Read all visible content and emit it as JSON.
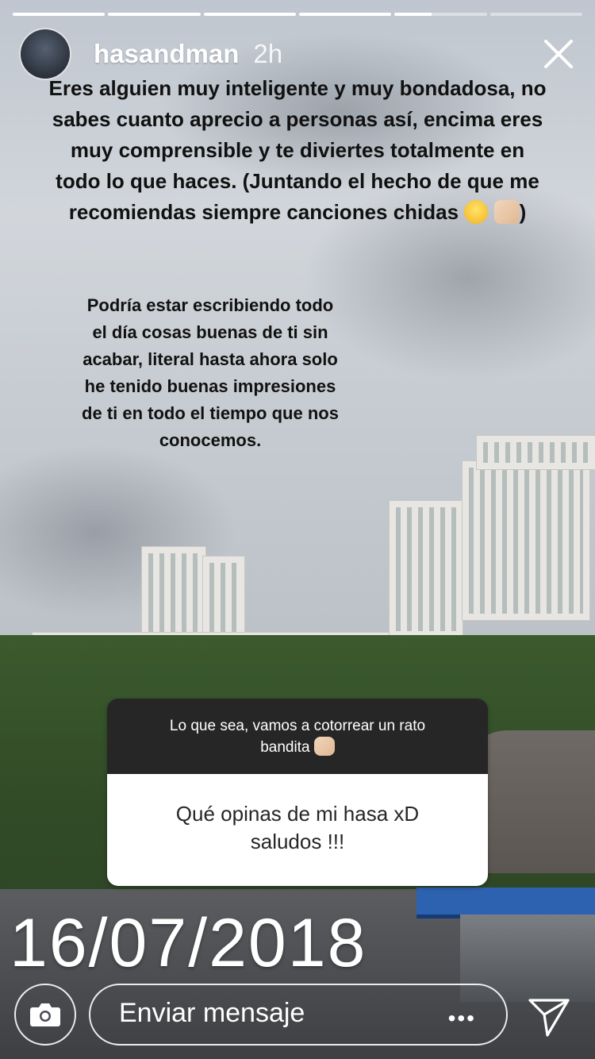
{
  "story": {
    "username": "hasandman",
    "time_ago": "2h",
    "progress_segments": [
      1,
      1,
      1,
      1,
      0.4,
      0
    ]
  },
  "texts": {
    "main_line_1": "Eres alguien muy inteligente y muy bondadosa, no",
    "main_line_2": "sabes cuanto aprecio a personas así, encima eres",
    "main_line_3": "muy comprensible y te diviertes totalmente en",
    "main_line_4": "todo lo que haces. (Juntando el hecho de que me",
    "main_line_5": "recomiendas siempre canciones chidas",
    "main_line_5_end": ")",
    "second_1": "Podría estar escribiendo todo",
    "second_2": "el día cosas buenas de ti sin",
    "second_3": "acabar, literal hasta ahora solo",
    "second_4": "he tenido buenas impresiones",
    "second_5": "de ti en todo el tiempo que nos",
    "second_6": "conocemos."
  },
  "question_card": {
    "prompt_line_1": "Lo que sea, vamos a cotorrear un rato",
    "prompt_line_2": "bandita",
    "answer_line_1": "Qué opinas de mi hasa xD",
    "answer_line_2": "saludos !!!"
  },
  "date_sticker": "16/07/2018",
  "footer": {
    "message_placeholder": "Enviar mensaje",
    "more": "•••"
  },
  "icons": {
    "camera": "camera-icon",
    "send": "send-icon",
    "close": "close-icon"
  },
  "colors": {
    "card_header": "#262626",
    "card_body": "#ffffff",
    "text_dark": "#111111"
  }
}
